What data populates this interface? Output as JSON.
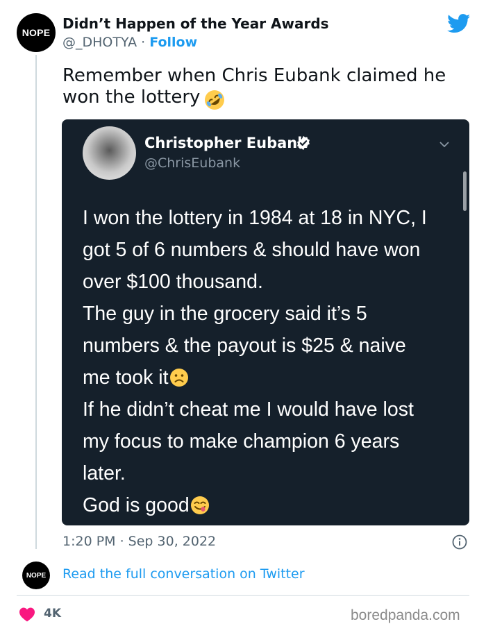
{
  "tweet": {
    "author": {
      "avatar_text": "NOPE",
      "name": "Didn’t Happen of the Year Awards",
      "handle": "@_DHOTYA",
      "separator": "·",
      "follow_label": "Follow"
    },
    "text_line1": "Remember when Chris Eubank claimed he",
    "text_line2": "won the lottery",
    "text_emoji": "rolling-on-floor-laughing-emoji",
    "embedded": {
      "name": "Christopher Eubank",
      "handle": "@ChrisEubank",
      "lines": [
        "I won the lottery in 1984 at 18 in NYC, I",
        "got 5 of 6 numbers & should have won",
        "over $100 thousand.",
        "The guy in the grocery said it’s 5",
        "numbers & the payout is $25 & naive",
        "me took it",
        "If he didn’t cheat me I would have lost",
        "my focus to make champion 6 years",
        "later.",
        "God is good"
      ],
      "inline_emojis": [
        "frowning-face-emoji",
        "face-savoring-food-emoji"
      ]
    },
    "timestamp": "1:20 PM · Sep 30, 2022",
    "reply": {
      "avatar_text": "NOPE",
      "link_text": "Read the full conversation on Twitter"
    },
    "likes": "4K"
  },
  "watermark": "boredpanda.com",
  "colors": {
    "link_blue": "#1d9bf0",
    "heart_red": "#f91880",
    "embed_bg": "#15202b"
  }
}
